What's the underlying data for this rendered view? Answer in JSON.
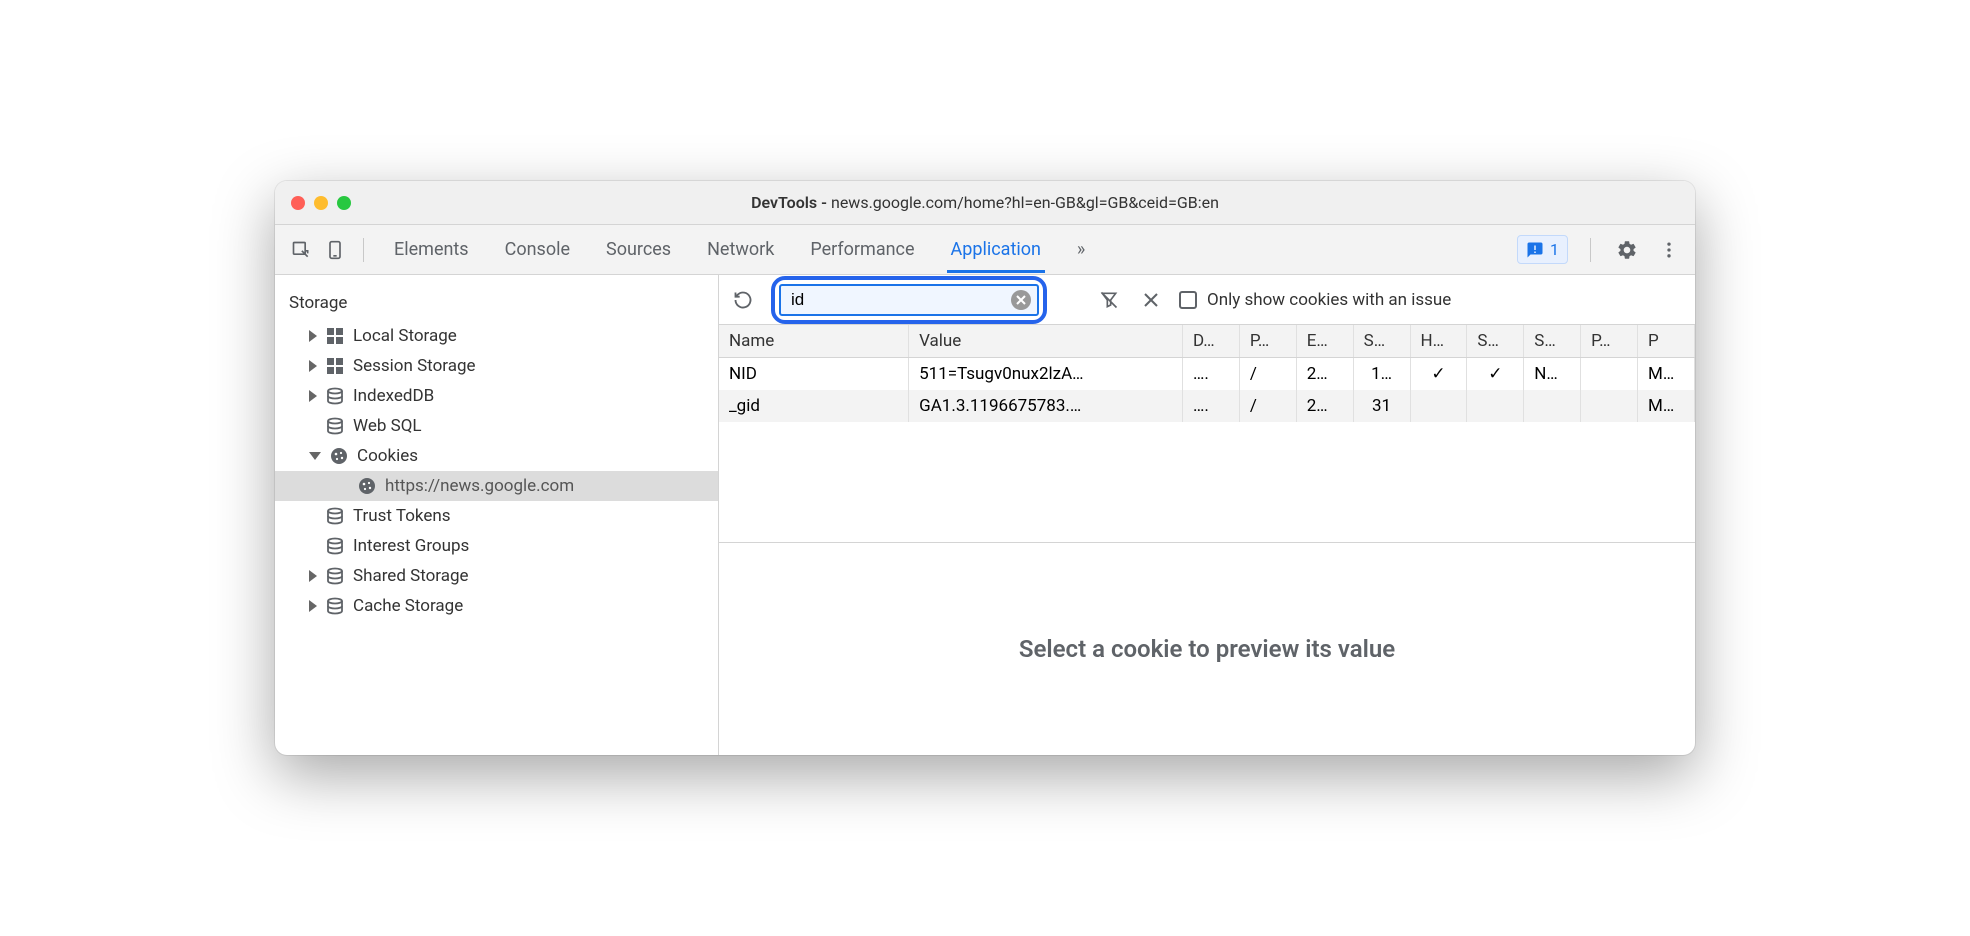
{
  "window": {
    "title_prefix": "DevTools - ",
    "title_url": "news.google.com/home?hl=en-GB&gl=GB&ceid=GB:en"
  },
  "toolbar": {
    "tabs": [
      "Elements",
      "Console",
      "Sources",
      "Network",
      "Performance",
      "Application"
    ],
    "active_tab": "Application",
    "more_symbol": "»",
    "issue_count": "1"
  },
  "sidebar": {
    "header": "Storage",
    "items": [
      {
        "label": "Local Storage",
        "icon": "grid",
        "expand": "right",
        "indent": 0
      },
      {
        "label": "Session Storage",
        "icon": "grid",
        "expand": "right",
        "indent": 0
      },
      {
        "label": "IndexedDB",
        "icon": "db",
        "expand": "right",
        "indent": 0
      },
      {
        "label": "Web SQL",
        "icon": "db",
        "expand": "none",
        "indent": 0
      },
      {
        "label": "Cookies",
        "icon": "cookie",
        "expand": "down",
        "indent": 0
      },
      {
        "label": "https://news.google.com",
        "icon": "cookie",
        "expand": "none",
        "indent": 1,
        "selected": true
      },
      {
        "label": "Trust Tokens",
        "icon": "db",
        "expand": "none",
        "indent": 0
      },
      {
        "label": "Interest Groups",
        "icon": "db",
        "expand": "none",
        "indent": 0
      },
      {
        "label": "Shared Storage",
        "icon": "db",
        "expand": "right",
        "indent": 0
      },
      {
        "label": "Cache Storage",
        "icon": "db",
        "expand": "right",
        "indent": 0
      }
    ]
  },
  "filter": {
    "value": "id",
    "checkbox_label": "Only show cookies with an issue"
  },
  "table": {
    "headers": [
      "Name",
      "Value",
      "D…",
      "P…",
      "E…",
      "S…",
      "H…",
      "S…",
      "S…",
      "P…",
      "P"
    ],
    "rows": [
      {
        "name": "NID",
        "value": "511=Tsugv0nux2lzA…",
        "d": "….",
        "p": "/",
        "e": "2…",
        "s": "1…",
        "h": "✓",
        "ss": "✓",
        "s2": "N…",
        "pr": "",
        "pp": "M…"
      },
      {
        "name": "_gid",
        "value": "GA1.3.1196675783.…",
        "d": "….",
        "p": "/",
        "e": "2…",
        "s": "31",
        "h": "",
        "ss": "",
        "s2": "",
        "pr": "",
        "pp": "M…"
      }
    ]
  },
  "preview": {
    "empty_text": "Select a cookie to preview its value"
  }
}
